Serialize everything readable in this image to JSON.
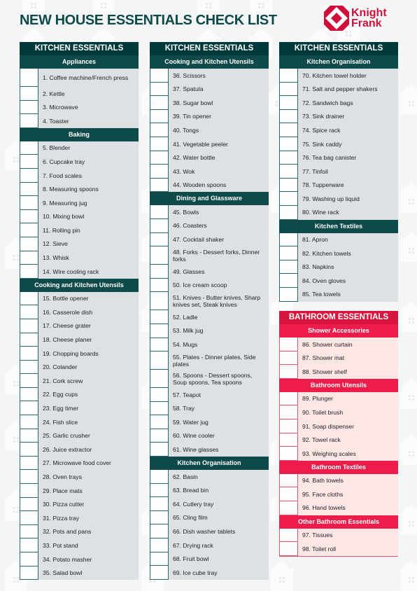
{
  "title": "NEW HOUSE ESSENTIALS CHECK LIST",
  "logo": {
    "line1": "Knight",
    "line2": "Frank",
    "color": "#d0103a"
  },
  "colors": {
    "kitchen_dark": "#00393a",
    "kitchen_sub": "#0e4a4a",
    "bath_dark": "#d6163f",
    "bath_sub": "#ee1c4a"
  },
  "columns": [
    {
      "header": "KITCHEN ESSENTIALS",
      "groups": [
        {
          "name": "Appliances",
          "items": [
            "1. Coffee machine/French press",
            "2. Kettle",
            "3. Microwave",
            "4. Toaster"
          ]
        },
        {
          "name": "Baking",
          "items": [
            "5. Blender",
            "6. Cupcake tray",
            "7. Food scales",
            "8. Measuring spoons",
            "9. Measuring jug",
            "10. Mixing bowl",
            "11. Rolling pin",
            "12. Sieve",
            "13. Whisk",
            "14. Wire cooling rack"
          ]
        },
        {
          "name": "Cooking and Kitchen Utensils",
          "items": [
            "15. Bottle opener",
            "16. Casserole dish",
            "17. Cheese grater",
            "18. Cheese planer",
            "19. Chopping boards",
            "20. Colander",
            "21. Cork screw",
            "22. Egg cups",
            "23. Egg timer",
            "24. Fish slice",
            "25. Garlic crusher",
            "26. Juice extractor",
            "27. Microwave food cover",
            "28. Oven trays",
            "29. Place mats",
            "30. Pizza cutter",
            "31. Pizza tray",
            "32. Pots and pans",
            "33. Pot stand",
            "34. Potato masher",
            "35. Salad bowl"
          ]
        }
      ]
    },
    {
      "header": "KITCHEN ESSENTIALS",
      "groups": [
        {
          "name": "Cooking and Kitchen Utensils",
          "items": [
            "36. Scissors",
            "37. Spatula",
            "38. Sugar bowl",
            "39. Tin opener",
            "40. Tongs",
            "41. Vegetable peeler",
            "42. Water bottle",
            "43. Wok",
            "44. Wooden spoons"
          ]
        },
        {
          "name": "Dining and Glassware",
          "items": [
            "45. Bowls",
            "46. Coasters",
            "47. Cocktail shaker",
            "48. Forks - Dessert forks, Dinner forks",
            "49. Glasses",
            "50. Ice cream scoop",
            "51. Knives - Butter knives, Sharp knives set, Steak knives",
            "52. Ladle",
            "53. Milk jug",
            "54. Mugs",
            "55. Plates - Dinner plates, Side plates",
            "56. Spoons - Dessert spoons, Soup spoons, Tea spoons",
            "57. Teapot",
            "58. Tray",
            "59. Water jug",
            "60. Wine cooler",
            "61. Wine glasses"
          ]
        },
        {
          "name": "Kitchen Organisation",
          "items": [
            "62. Basin",
            "63. Bread bin",
            "64. Cutlery tray",
            "65. Cling film",
            "66. Dish washer tablets",
            "67. Drying rack",
            "68. Fruit bowl",
            "69. Ice cube tray"
          ]
        }
      ]
    },
    {
      "header": "KITCHEN ESSENTIALS",
      "groups": [
        {
          "name": "Kitchen Organisation",
          "items": [
            "70. Kitchen towel holder",
            "71. Salt and pepper shakers",
            "72. Sandwich bags",
            "73. Sink drainer",
            "74. Spice rack",
            "75. Sink caddy",
            "76. Tea bag canister",
            "77. Tinfoil",
            "78. Tupperware",
            "79. Washing up liquid",
            "80. Wine rack"
          ]
        },
        {
          "name": "Kitchen Textiles",
          "items": [
            "81. Apron",
            "82. Kitchen towels",
            "83. Napkins",
            "84. Oven gloves",
            "85. Tea towels"
          ]
        }
      ]
    },
    {
      "header": "BATHROOM ESSENTIALS",
      "groups": [
        {
          "name": "Shower Accessories",
          "items": [
            "86. Shower curtain",
            "87. Shower mat",
            "88. Shower shelf"
          ]
        },
        {
          "name": "Bathroom Utensils",
          "items": [
            "89. Plunger",
            "90. Toilet brush",
            "91. Soap dispenser",
            "92. Towel rack",
            "93. Weighing scales"
          ]
        },
        {
          "name": "Bathroom Textiles",
          "items": [
            "94. Bath towels",
            "95. Face cloths",
            "96. Hand towels"
          ]
        },
        {
          "name": "Other Bathroom Essentials",
          "items": [
            "97. Tissues",
            "98. Toilet roll"
          ]
        }
      ]
    }
  ]
}
